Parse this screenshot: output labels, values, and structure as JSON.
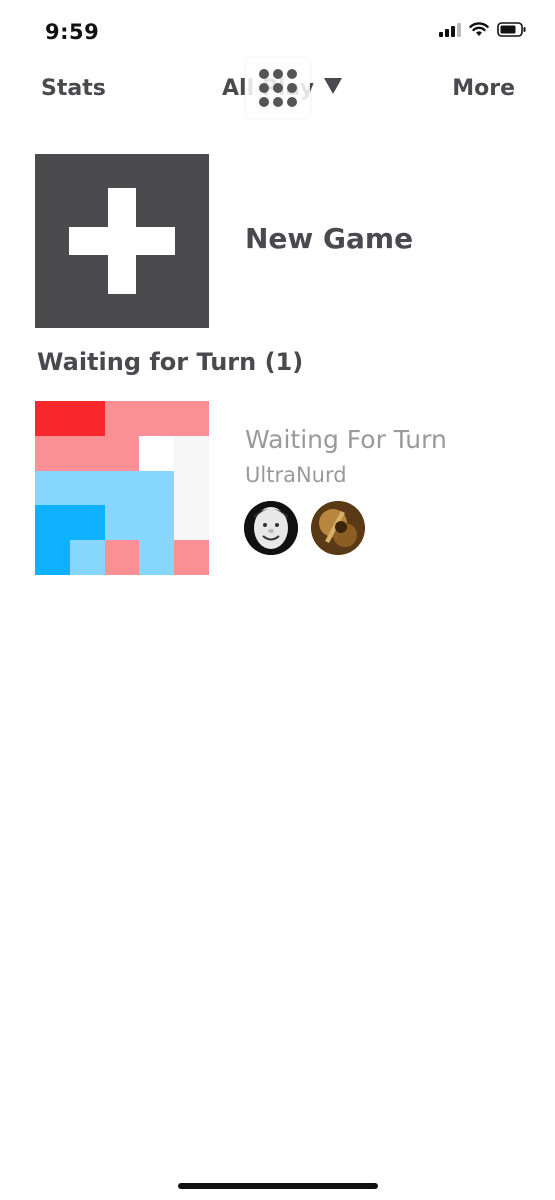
{
  "status_bar": {
    "time": "9:59",
    "icons": [
      "signal-icon",
      "wifi-icon",
      "battery-icon"
    ]
  },
  "nav": {
    "left_label": "Stats",
    "center_label": "All Play",
    "right_label": "More",
    "dropdown_icon": "triangle-down-icon",
    "overlay_icon": "dot-grid-icon"
  },
  "new_game": {
    "label": "New Game",
    "icon": "plus-icon",
    "tile_color": "#4b4a4d"
  },
  "sections": [
    {
      "header": "Waiting for Turn (1)",
      "games": [
        {
          "title": "Waiting For Turn",
          "opponent": "UltraNurd",
          "avatars": [
            "player-avatar",
            "opponent-avatar"
          ],
          "board": [
            [
              "#f8272b",
              "#f8272b",
              "#fb8f96",
              "#fb8f96",
              "#fb8f96"
            ],
            [
              "#fb8f96",
              "#fb8f96",
              "#fb8f96",
              "#ffffff",
              "#f6f6f7"
            ],
            [
              "#87d6fd",
              "#87d6fd",
              "#87d6fd",
              "#87d6fd",
              "#f6f6f7"
            ],
            [
              "#0eb1fd",
              "#0eb1fd",
              "#87d6fd",
              "#87d6fd",
              "#f6f6f7"
            ],
            [
              "#0eb1fd",
              "#87d6fd",
              "#fb8f96",
              "#87d6fd",
              "#fb8f96"
            ]
          ]
        }
      ]
    }
  ],
  "colors": {
    "text_dark": "#4a4a4e",
    "text_muted": "#9a9a9e",
    "red_strong": "#f8272b",
    "red_light": "#fb8f96",
    "blue_strong": "#0eb1fd",
    "blue_light": "#87d6fd"
  }
}
